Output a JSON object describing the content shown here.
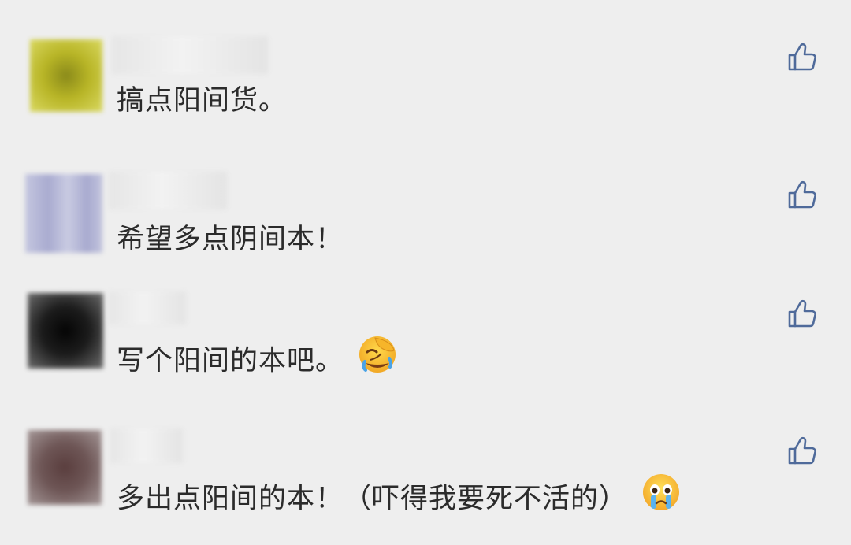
{
  "comments": [
    {
      "text": "搞点阳间货。",
      "emoji": "",
      "avatar_color": "#b8b526"
    },
    {
      "text": "希望多点阴间本！",
      "emoji": "",
      "avatar_color": "#b7b9d8"
    },
    {
      "text": "写个阳间的本吧。",
      "emoji": "face-palm-laughing-emoji",
      "avatar_color": "#1c1c1c"
    },
    {
      "text": "多出点阳间的本！（吓得我要死不活的）",
      "emoji": "crying-face-emoji",
      "avatar_color": "#6e5656"
    }
  ],
  "icons": {
    "like": "thumbs-up-icon"
  },
  "colors": {
    "background": "#eeeeee",
    "text": "#2b2b2b",
    "like_icon": "#4f6a9a"
  }
}
